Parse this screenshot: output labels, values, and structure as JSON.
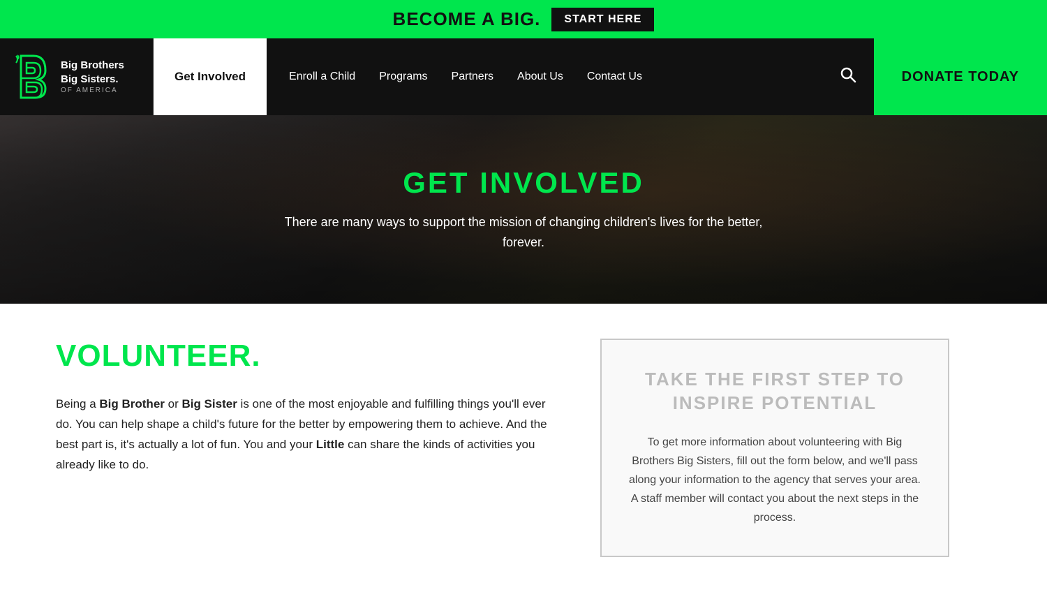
{
  "top_banner": {
    "text": "BECOME A BIG.",
    "cta_label": "START HERE"
  },
  "nav": {
    "logo": {
      "main_name": "Big Brothers\nBig Sisters.",
      "sub_name": "OF AMERICA"
    },
    "active_tab": "Get Involved",
    "links": [
      {
        "label": "Enroll a Child"
      },
      {
        "label": "Programs"
      },
      {
        "label": "Partners"
      },
      {
        "label": "About Us"
      },
      {
        "label": "Contact Us"
      }
    ],
    "donate_label": "DONATE TODAY",
    "search_icon": "🔍"
  },
  "hero": {
    "title": "GET INVOLVED",
    "subtitle": "There are many ways to support the mission of changing children's lives for the better, forever."
  },
  "main": {
    "volunteer": {
      "heading": "VOLUNTEER.",
      "body_parts": [
        "Being a ",
        "Big Brother",
        " or ",
        "Big Sister",
        " is one of the most enjoyable and fulfilling things you'll ever do. You can help shape a child's future for the better by empowering them to achieve. And the best part is, it's actually a lot of fun. You and your ",
        "Little",
        " can share the kinds of activities you already like to do."
      ]
    },
    "inspire_panel": {
      "title": "TAKE THE FIRST STEP TO INSPIRE POTENTIAL",
      "body": "To get more information about volunteering with Big Brothers Big Sisters, fill out the form below, and we'll pass along your information to the agency that serves your area. A staff member will contact you about the next steps in the process."
    }
  }
}
